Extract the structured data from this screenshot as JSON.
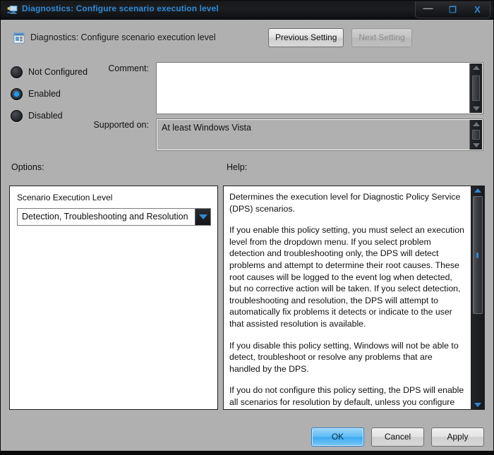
{
  "window": {
    "title": "Diagnostics: Configure scenario execution level",
    "title_icon": "computer-user-icon",
    "controls": {
      "minimize": "—",
      "restore": "❐",
      "close": "X"
    }
  },
  "header": {
    "icon": "policy-setting-icon",
    "title": "Diagnostics: Configure scenario execution level",
    "previous_setting": "Previous Setting",
    "next_setting": "Next Setting"
  },
  "state": {
    "options": [
      {
        "label": "Not Configured",
        "selected": false
      },
      {
        "label": "Enabled",
        "selected": true
      },
      {
        "label": "Disabled",
        "selected": false
      }
    ]
  },
  "comment": {
    "label": "Comment:",
    "value": ""
  },
  "supported_on": {
    "label": "Supported on:",
    "value": "At least Windows Vista"
  },
  "options_section": {
    "label": "Options:",
    "setting_title": "Scenario Execution Level",
    "dropdown_value": "Detection, Troubleshooting and Resolution",
    "dropdown_icon": "chevron-down-icon"
  },
  "help_section": {
    "label": "Help:",
    "paragraphs": [
      "Determines the execution level for Diagnostic Policy Service (DPS) scenarios.",
      "If you enable this policy setting, you must select an execution level from the dropdown menu.  If you select problem detection and troubleshooting only, the DPS will detect problems and attempt to determine their root causes.  These root causes will be logged to the event log when detected, but no corrective action will be taken.  If you select detection, troubleshooting and resolution, the DPS will attempt to automatically fix problems it detects or indicate to the user that assisted resolution is available.",
      "If you disable this policy setting, Windows will not be able to detect, troubleshoot or resolve any problems that are handled by the DPS.",
      "If you do not configure this policy setting, the DPS will enable all scenarios for resolution by default, unless you configure separate scenario-specific policy settings."
    ]
  },
  "footer": {
    "ok": "OK",
    "cancel": "Cancel",
    "apply": "Apply"
  },
  "colors": {
    "title_text": "#2f8ad6",
    "accent": "#2f8ad6",
    "dialog_bg": "#b0b0b0",
    "default_button": "#5fbdf5"
  }
}
